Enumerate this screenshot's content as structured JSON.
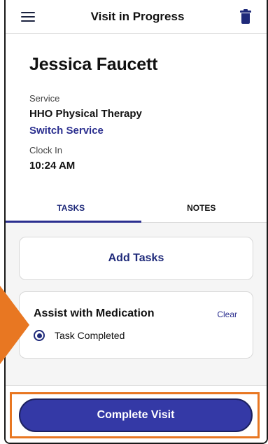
{
  "header": {
    "title": "Visit in Progress",
    "menu_icon": "hamburger-menu-icon",
    "delete_icon": "trash-icon"
  },
  "patient": {
    "name": "Jessica Faucett",
    "service_label": "Service",
    "service_value": "HHO Physical Therapy",
    "switch_service": "Switch Service",
    "clock_in_label": "Clock In",
    "clock_in_value": "10:24 AM"
  },
  "tabs": [
    {
      "label": "TASKS",
      "active": true
    },
    {
      "label": "NOTES",
      "active": false
    }
  ],
  "tasks": {
    "add_label": "Add Tasks",
    "items": [
      {
        "title": "Assist with Medication",
        "clear_label": "Clear",
        "option_label": "Task Completed",
        "selected": true
      }
    ]
  },
  "footer": {
    "complete_label": "Complete Visit"
  },
  "colors": {
    "brand": "#1f2a7a",
    "button": "#3439a6",
    "highlight": "#e87722"
  }
}
